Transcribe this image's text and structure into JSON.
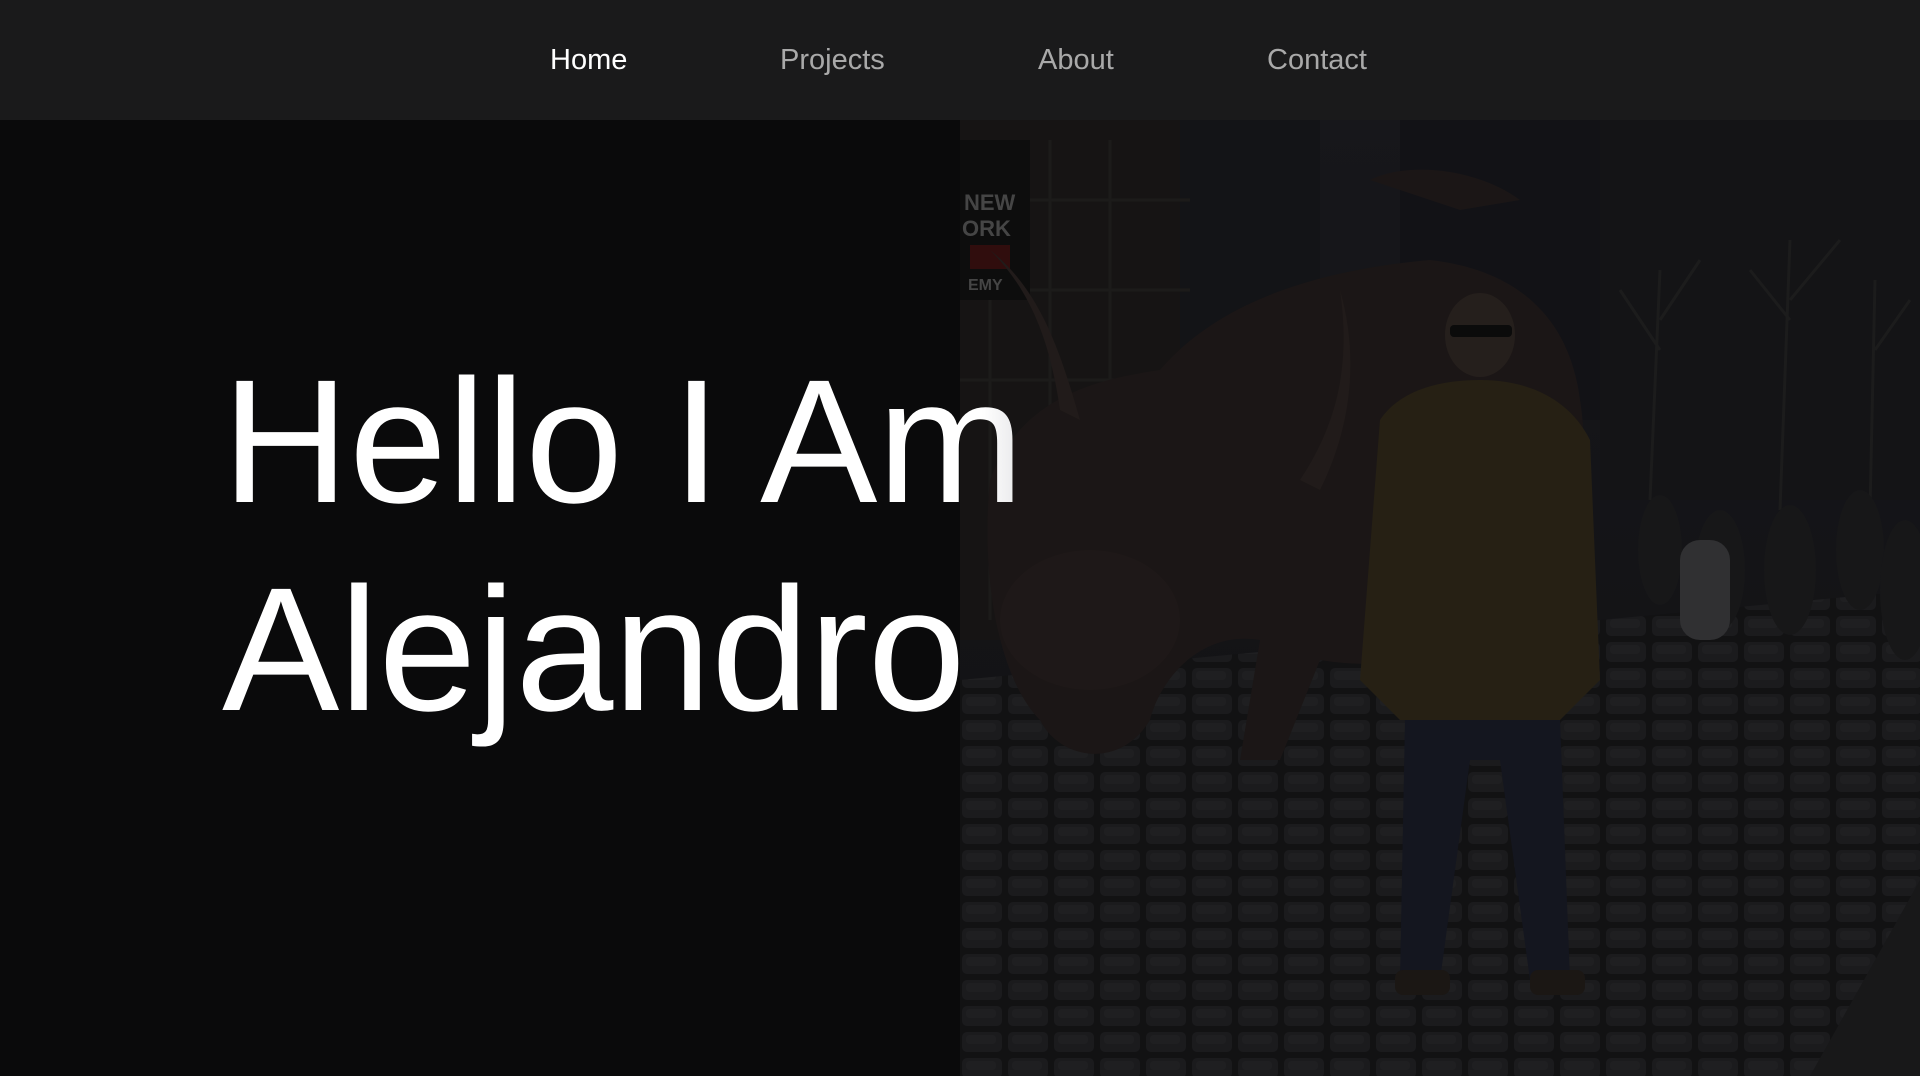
{
  "nav": {
    "items": [
      {
        "label": "Home",
        "active": true
      },
      {
        "label": "Projects",
        "active": false
      },
      {
        "label": "About",
        "active": false
      },
      {
        "label": "Contact",
        "active": false
      }
    ]
  },
  "hero": {
    "line1": "Hello I Am",
    "line2": "Alejandro",
    "sign_text": "NEW\nORK\nEMY"
  },
  "colors": {
    "nav_bg": "#1a1a1b",
    "page_bg": "#0a0a0b",
    "text_active": "#ffffff",
    "text_inactive": "#a9a9a9"
  }
}
